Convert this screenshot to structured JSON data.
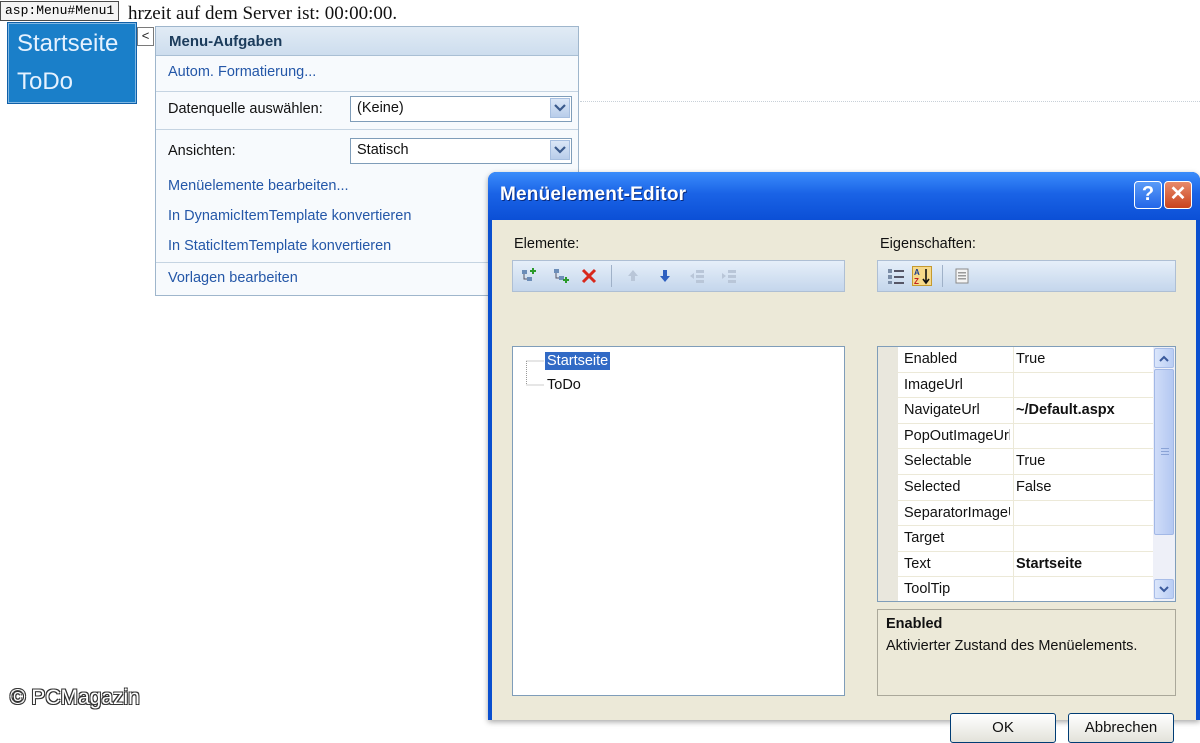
{
  "page": {
    "text": "hrzeit auf dem Server ist: 00:00:00."
  },
  "menu_control": {
    "tag": "asp:Menu#Menu1",
    "items": [
      "Startseite",
      "ToDo"
    ],
    "smart_tag_glyph": "<",
    "background_color": "#1a7fc9"
  },
  "task_panel": {
    "title": "Menu-Aufgaben",
    "autoformat_link": "Autom. Formatierung...",
    "datasource_label": "Datenquelle auswählen:",
    "datasource_value": "(Keine)",
    "views_label": "Ansichten:",
    "views_value": "Statisch",
    "links": [
      "Menüelemente bearbeiten...",
      "In DynamicItemTemplate konvertieren",
      "In StaticItemTemplate konvertieren"
    ],
    "templates_link": "Vorlagen bearbeiten"
  },
  "dialog": {
    "title": "Menüelement-Editor",
    "help_glyph": "?",
    "close_glyph": "✕",
    "elements_label": "Elemente:",
    "properties_label": "Eigenschaften:",
    "toolbar_icons": [
      "add-root-item-icon",
      "add-child-item-icon",
      "delete-icon",
      "move-up-icon",
      "move-down-icon",
      "outdent-icon",
      "indent-icon"
    ],
    "tree": [
      {
        "label": "Startseite",
        "selected": true
      },
      {
        "label": "ToDo",
        "selected": false
      }
    ],
    "properties": [
      {
        "name": "Enabled",
        "value": "True",
        "bold": false
      },
      {
        "name": "ImageUrl",
        "value": "",
        "bold": false
      },
      {
        "name": "NavigateUrl",
        "value": "~/Default.aspx",
        "bold": true
      },
      {
        "name": "PopOutImageUrl",
        "value": "",
        "bold": false
      },
      {
        "name": "Selectable",
        "value": "True",
        "bold": false
      },
      {
        "name": "Selected",
        "value": "False",
        "bold": false
      },
      {
        "name": "SeparatorImageUrl",
        "value": "",
        "bold": false
      },
      {
        "name": "Target",
        "value": "",
        "bold": false
      },
      {
        "name": "Text",
        "value": "Startseite",
        "bold": true
      },
      {
        "name": "ToolTip",
        "value": "",
        "bold": false
      }
    ],
    "description_title": "Enabled",
    "description_text": "Aktivierter Zustand des Menüelements.",
    "ok_label": "OK",
    "cancel_label": "Abbrechen"
  },
  "copyright": "© PCMagazin"
}
